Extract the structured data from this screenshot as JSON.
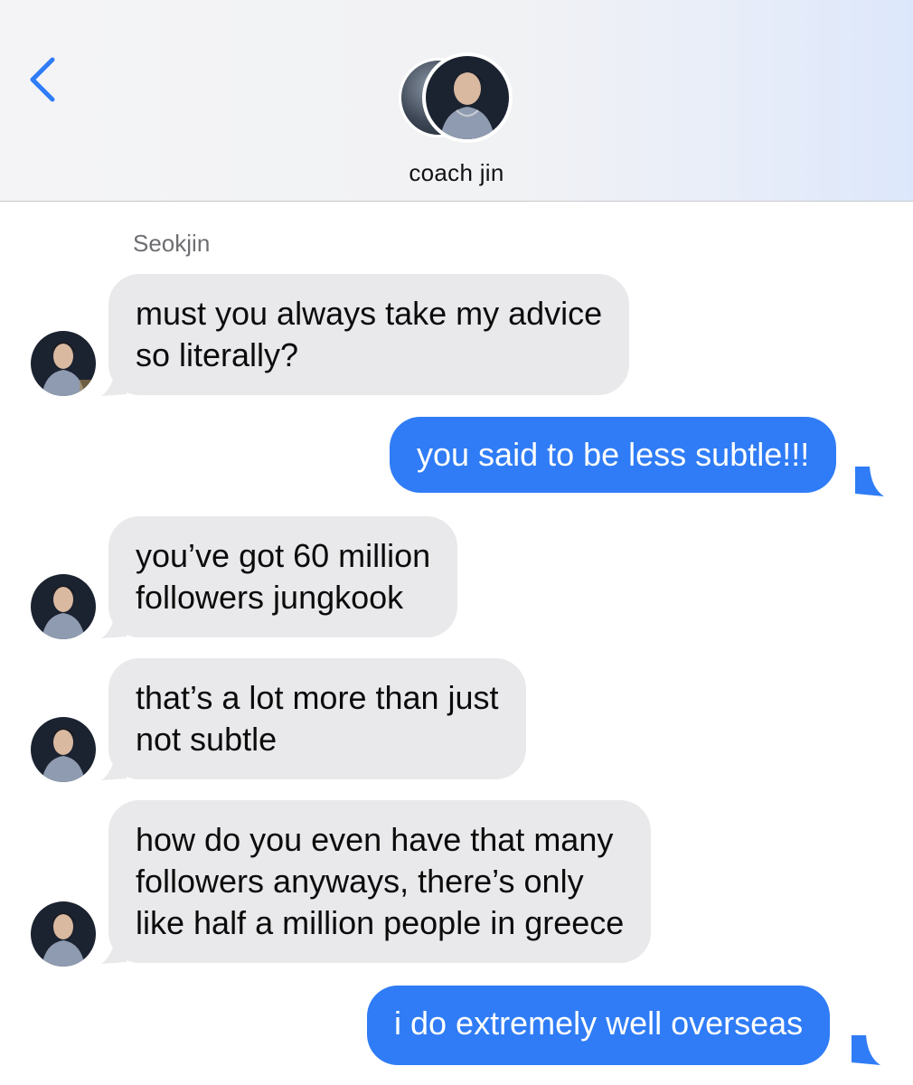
{
  "header": {
    "contact_name": "coach jin",
    "back_icon": "chevron-left-icon"
  },
  "thread": {
    "sender_name": "Seokjin",
    "messages": [
      {
        "direction": "incoming",
        "lines": [
          "must you always take my advice",
          "so literally?"
        ]
      },
      {
        "direction": "outgoing",
        "lines": [
          "you said to be less subtle!!!"
        ]
      },
      {
        "direction": "incoming",
        "lines": [
          "you’ve got 60 million",
          "followers jungkook"
        ]
      },
      {
        "direction": "incoming",
        "lines": [
          "that’s a lot more than just",
          "not subtle"
        ]
      },
      {
        "direction": "incoming",
        "lines": [
          "how do you even have that many",
          "followers anyways, there’s only",
          "like half a million people in greece"
        ]
      },
      {
        "direction": "outgoing",
        "lines": [
          "i do extremely well overseas"
        ]
      }
    ]
  },
  "colors": {
    "incoming_bubble": "#e9e9eb",
    "outgoing_bubble": "#2f7cf6",
    "accent": "#2f7cf6"
  }
}
